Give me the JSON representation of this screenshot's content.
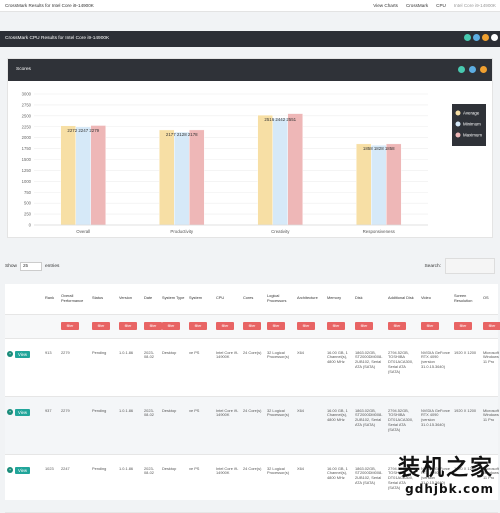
{
  "topnav": {
    "brand": "CrossMark Results for Intel Core i9-14900K",
    "links": [
      "View Charts",
      "CrossMark",
      "CPU",
      "Intel Core i9-14900K"
    ]
  },
  "header": {
    "title": "CrossMark CPU Results for Intel Core i9-14900K"
  },
  "scores": {
    "title": "Scores",
    "dot_colors": [
      "#48c9b0",
      "#5dade2",
      "#f0a030"
    ]
  },
  "chart_data": {
    "type": "bar",
    "categories": [
      "Overall",
      "Productivity",
      "Creativity",
      "Responsiveness"
    ],
    "ylim": [
      0,
      3000
    ],
    "yticks": [
      0,
      250,
      500,
      750,
      1000,
      1250,
      1500,
      1750,
      2000,
      2250,
      2500,
      2750,
      3000
    ],
    "series": [
      {
        "name": "Average",
        "color": "#f7dfa5",
        "values": [
          2272,
          2177,
          2516,
          1858
        ]
      },
      {
        "name": "Minimum",
        "color": "#d6e9f8",
        "values": [
          2247,
          2128,
          2442,
          1828
        ]
      },
      {
        "name": "Maximum",
        "color": "#eeb7b7",
        "values": [
          2279,
          2178,
          2551,
          1858
        ]
      }
    ],
    "data_labels": [
      "2272 2247 2279",
      "2177 2128 2178",
      "2516 2442 2551",
      "1858 1828 1858"
    ],
    "legend_position": "top-right"
  },
  "controls": {
    "show_label": "Show",
    "entries_value": "25",
    "entries_label": "entries",
    "search_label": "Search:"
  },
  "table": {
    "headers": [
      "",
      "Rank",
      "Overall Performance",
      "Status",
      "Version",
      "Date",
      "System Type",
      "System",
      "CPU",
      "Cores",
      "Logical Processors",
      "Architecture",
      "Memory",
      "Disk",
      "Additional Disk",
      "Video",
      "Screen Resolution",
      "OS"
    ],
    "filter_label": "filter",
    "view_label": "View",
    "rows": [
      [
        "913",
        "2279",
        "Pending",
        "1.0.1.86",
        "2023-08-02",
        "Desktop",
        "xe PS",
        "Intel Core i9-14900K",
        "24 Core(s)",
        "32 Logical Processor(s)",
        "X64",
        "16.00 GB, 1 Channel(s), 4800 MHz",
        "1863.02GB, ST2000DM008-2UB102, Serial ATA (SATA)",
        "2794.52GB, TOSHIBA DT01ACA300, Serial ATA (SATA)",
        "NVIDIA GeForce RTX 4090 (version 31.0.15.3640)",
        "1920 X 1200",
        "Microsoft Windows 11 Pro"
      ],
      [
        "937",
        "2279",
        "Pending",
        "1.0.1.86",
        "2023-08-02",
        "Desktop",
        "xe PS",
        "Intel Core i9-14900K",
        "24 Core(s)",
        "32 Logical Processor(s)",
        "X64",
        "16.00 GB, 1 Channel(s), 4800 MHz",
        "1863.02GB, ST2000DM008-2UB102, Serial ATA (SATA)",
        "2794.52GB, TOSHIBA DT01ACA300, Serial ATA (SATA)",
        "NVIDIA GeForce RTX 4090 (version 31.0.15.3640)",
        "1920 X 1200",
        "Microsoft Windows 11 Pro"
      ],
      [
        "1023",
        "2247",
        "Pending",
        "1.0.1.86",
        "2023-08-02",
        "Desktop",
        "xe PS",
        "Intel Core i9-14900K",
        "24 Core(s)",
        "32 Logical Processor(s)",
        "X64",
        "16.00 GB, 1 Channel(s), 4800 MHz",
        "1863.02GB, ST2000DM008-2UB102, Serial ATA (SATA)",
        "2794.52GB, TOSHIBA DT01ACA300, Serial ATA (SATA)",
        "NVIDIA GeForce RTX 4090 (version 31.0.15.3640)",
        "1920 X 1200",
        "Microsoft Windows 11 Pro"
      ]
    ]
  },
  "watermark": {
    "text": "装机之家",
    "url": "gdhjbk.com"
  }
}
